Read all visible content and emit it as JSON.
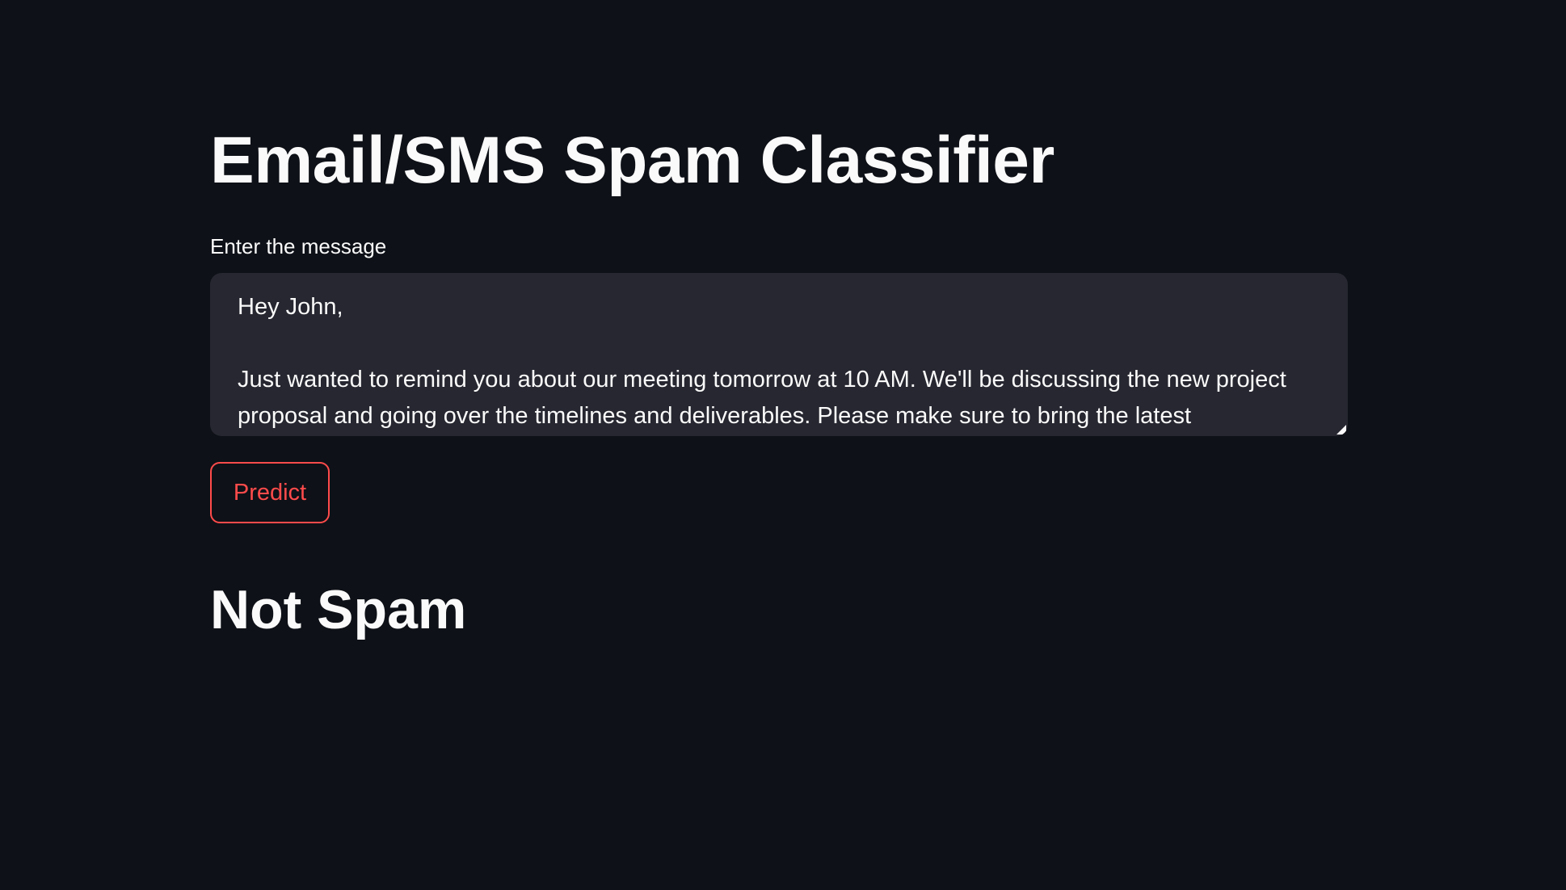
{
  "page": {
    "title": "Email/SMS Spam Classifier"
  },
  "input": {
    "label": "Enter the message",
    "value": "Hey John,\n\nJust wanted to remind you about our meeting tomorrow at 10 AM. We'll be discussing the new project proposal and going over the timelines and deliverables. Please make sure to bring the latest"
  },
  "actions": {
    "predict_label": "Predict"
  },
  "result": {
    "text": "Not Spam"
  },
  "colors": {
    "background": "#0e1117",
    "input_background": "#262730",
    "accent": "#ff4b4b",
    "text": "#fafafa"
  }
}
